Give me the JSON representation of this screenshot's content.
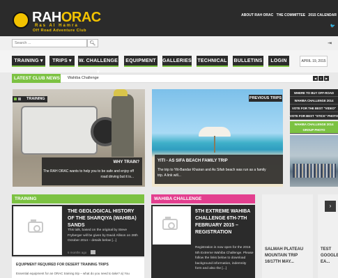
{
  "brand": {
    "title_a": "RAH",
    "title_b": "ORAC",
    "tagline_1": "Ras Al Hamra",
    "tagline_2": "Off Road Adventure Club"
  },
  "toplinks": [
    "ABOUT RAH ORAC",
    "THE COMMITTEE",
    "2015 CALENDAR"
  ],
  "search": {
    "placeholder": "Search ..."
  },
  "nav": {
    "items": [
      "TRAINING",
      "TRIPS",
      "W. CHALLENGE",
      "EQUIPMENT",
      "GALLERIES",
      "TECHNICAL",
      "BULLETINS",
      "LOGIN"
    ],
    "date": "APRIL 19, 2015"
  },
  "news": {
    "label": "LATEST CLUB NEWS",
    "text": "Wahiba Challenge"
  },
  "slide1": {
    "tag": "TRAINING",
    "title": "WHY TRAIN?",
    "text": "The RAH ORAC wants to help you to be safe and enjoy off road driving but it is..."
  },
  "slide2": {
    "tag": "PREVIOUS TRIPS",
    "title": "YITI - AS SIFA BEACH FAMILY TRIP",
    "text": "The trip to Yiti-Bandar Khairan and As Sifah beach was run as a family trip. A link will..."
  },
  "sidebar": {
    "items": [
      "WHERE TO BUY OFF-ROAD",
      "WAHIBA CHALLENGE 2014",
      "VOTE FOR THE BEST \"VIDEO\"",
      "VOTE FOR BEST \"STICK\" PHOTO"
    ],
    "highlight": "WAHIBA CHALLENGE 2014 GROUP PHOTO"
  },
  "card_training": {
    "section": "TRAINING",
    "title": "THE GEOLOGICAL HISTORY OF THE SHARQIYA (WAHIBA) SANDS",
    "text": "This talk, based on the original by Steve Fryberger will be given by David Allison on 28th October 2014 – details below [...]",
    "meta": "6 months ago",
    "sub_title": "EQUIPMENT REQUIRED FOR DESERT TRAINING TRIPS",
    "sub_text": "Essential equipment for an ORAC training trip – what do you need to take? a) You"
  },
  "card_wahiba": {
    "section": "WAHIBA CHALLENGE",
    "title": "5TH EXTREME WAHIBA CHALLENGE 6TH-7TH FEBRUARY 2015 – REGISTRATION",
    "text": "Registration is now open for the 2015 5th Extreme Wahiba Challenge. Please follow the links below to download background information, indemnity form and also the [...]"
  },
  "card_right": [
    {
      "title": "SALMAH PLATEAU MOUNTAIN TRIP 16/17TH MAY..."
    },
    {
      "title": "TEST GOOGLE EA..."
    }
  ],
  "colors": {
    "dark": "#2b2b2b",
    "green": "#7cc242",
    "yellow": "#f2c200",
    "pink": "#e33f8f",
    "orange": "#f28a20"
  }
}
